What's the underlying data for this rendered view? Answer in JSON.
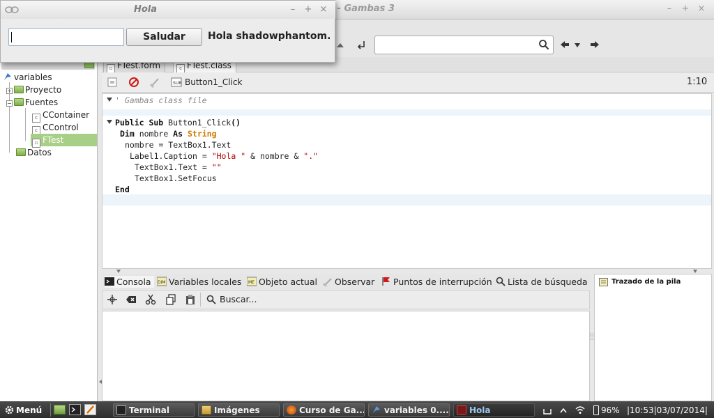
{
  "hola_window": {
    "title": "Hola",
    "input_value": "",
    "button_label": "Saludar",
    "greeting_label": "Hola shadowphantom."
  },
  "ide": {
    "title": "1 - Gambas 3",
    "tree": {
      "root": "variables",
      "items": [
        "Proyecto",
        "Fuentes",
        "CContainer",
        "CControl",
        "FTest",
        "Datos"
      ]
    },
    "tabs": [
      "FTest.form",
      "FTest.class"
    ],
    "procedure": "Button1_Click",
    "cursor": "1:10",
    "code_lines": {
      "comment": "' Gambas class file",
      "l1_kw": "Public Sub",
      "l1_rest": " Button1_Click",
      "l1_paren": "()",
      "l2_kw": "Dim",
      "l2_mid": " nombre ",
      "l2_as": "As",
      "l2_type": "String",
      "l3": "nombre = TextBox1.Text",
      "l4_a": "Label1.Caption = ",
      "l4_s1": "\"Hola \"",
      "l4_b": " & nombre & ",
      "l4_s2": "\".\"",
      "l5_a": "TextBox1.Text = ",
      "l5_s": "\"\"",
      "l6": "TextBox1.SetFocus",
      "l7": "End"
    },
    "bottom_tabs": [
      "Consola",
      "Variables locales",
      "Objeto actual",
      "Observar",
      "Puntos de interrupción",
      "Lista de búsqueda"
    ],
    "console_search": "Buscar...",
    "stack_title": "Trazado de la pila"
  },
  "taskbar": {
    "menu": "Menú",
    "tasks": [
      "Terminal",
      "Imágenes",
      "Curso de Ga...",
      "variables 0....",
      "Hola"
    ],
    "battery": "96%",
    "clock": "|10:53|03/07/2014|"
  },
  "colors": {
    "type_keyword": "#d07a00",
    "string": "#b00000",
    "comment": "#888888",
    "tree_selected": "#a7cf85"
  }
}
